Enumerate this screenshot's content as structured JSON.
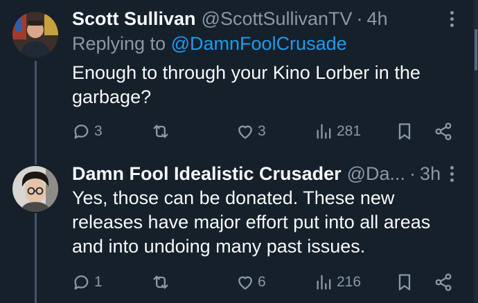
{
  "tweets": [
    {
      "author_name": "Scott Sullivan",
      "handle": "@ScottSullivanTV",
      "separator": "·",
      "time": "4h",
      "replying_prefix": "Replying to",
      "replying_to": "@DamnFoolCrusade",
      "text_lines": [
        "Enough to through your Kino Lorber in the",
        "garbage?"
      ],
      "stats": {
        "replies": "3",
        "retweets": "",
        "likes": "3",
        "views": "281"
      }
    },
    {
      "author_name": "Damn Fool Idealistic Crusader",
      "handle": "@Da...",
      "separator": "·",
      "time": "3h",
      "text_lines": [
        "Yes, those can be donated. These new",
        "releases have major effort put into all areas",
        "and into undoing many past issues."
      ],
      "stats": {
        "replies": "1",
        "retweets": "",
        "likes": "6",
        "views": "216"
      }
    }
  ],
  "icons": {
    "more": "more-vertical-icon",
    "reply": "reply-bubble-icon",
    "retweet": "retweet-icon",
    "like": "heart-icon",
    "views": "bar-chart-views-icon",
    "bookmark": "bookmark-icon",
    "share": "share-icon"
  },
  "colors": {
    "background": "#15202b",
    "primary_text": "#f7f9f9",
    "secondary_text": "#8b98a5",
    "link": "#1d9bf0",
    "thread_line": "#425466"
  }
}
